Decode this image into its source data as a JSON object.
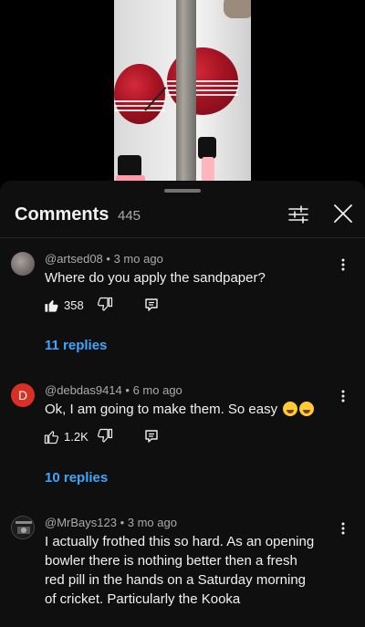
{
  "panel": {
    "title": "Comments",
    "count": "445"
  },
  "icons": {
    "filter": "sliders-icon",
    "close": "close-icon",
    "more": "more-vertical-icon",
    "like": "thumb-up-icon",
    "dislike": "thumb-down-icon",
    "reply": "reply-icon"
  },
  "colors": {
    "background": "#0f0f0f",
    "link": "#3ea6ff",
    "secondary_text": "#aaaaaa",
    "avatar_d": "#d93025"
  },
  "comments": [
    {
      "author": "@artsed08",
      "age": "3 mo ago",
      "text": "Where do you apply the sandpaper?",
      "likes": "358",
      "liked": true,
      "replies": "11 replies"
    },
    {
      "author": "@debdas9414",
      "age": "6 mo ago",
      "avatar_letter": "D",
      "text": "Ok, I am going to make them. So easy",
      "likes": "1.2K",
      "liked": false,
      "replies": "10 replies"
    },
    {
      "author": "@MrBays123",
      "age": "3 mo ago",
      "text": "I actually frothed this so hard. As an opening bowler there is nothing better then a fresh red pill in the hands on a Saturday morning of cricket. Particularly the Kooka"
    }
  ]
}
